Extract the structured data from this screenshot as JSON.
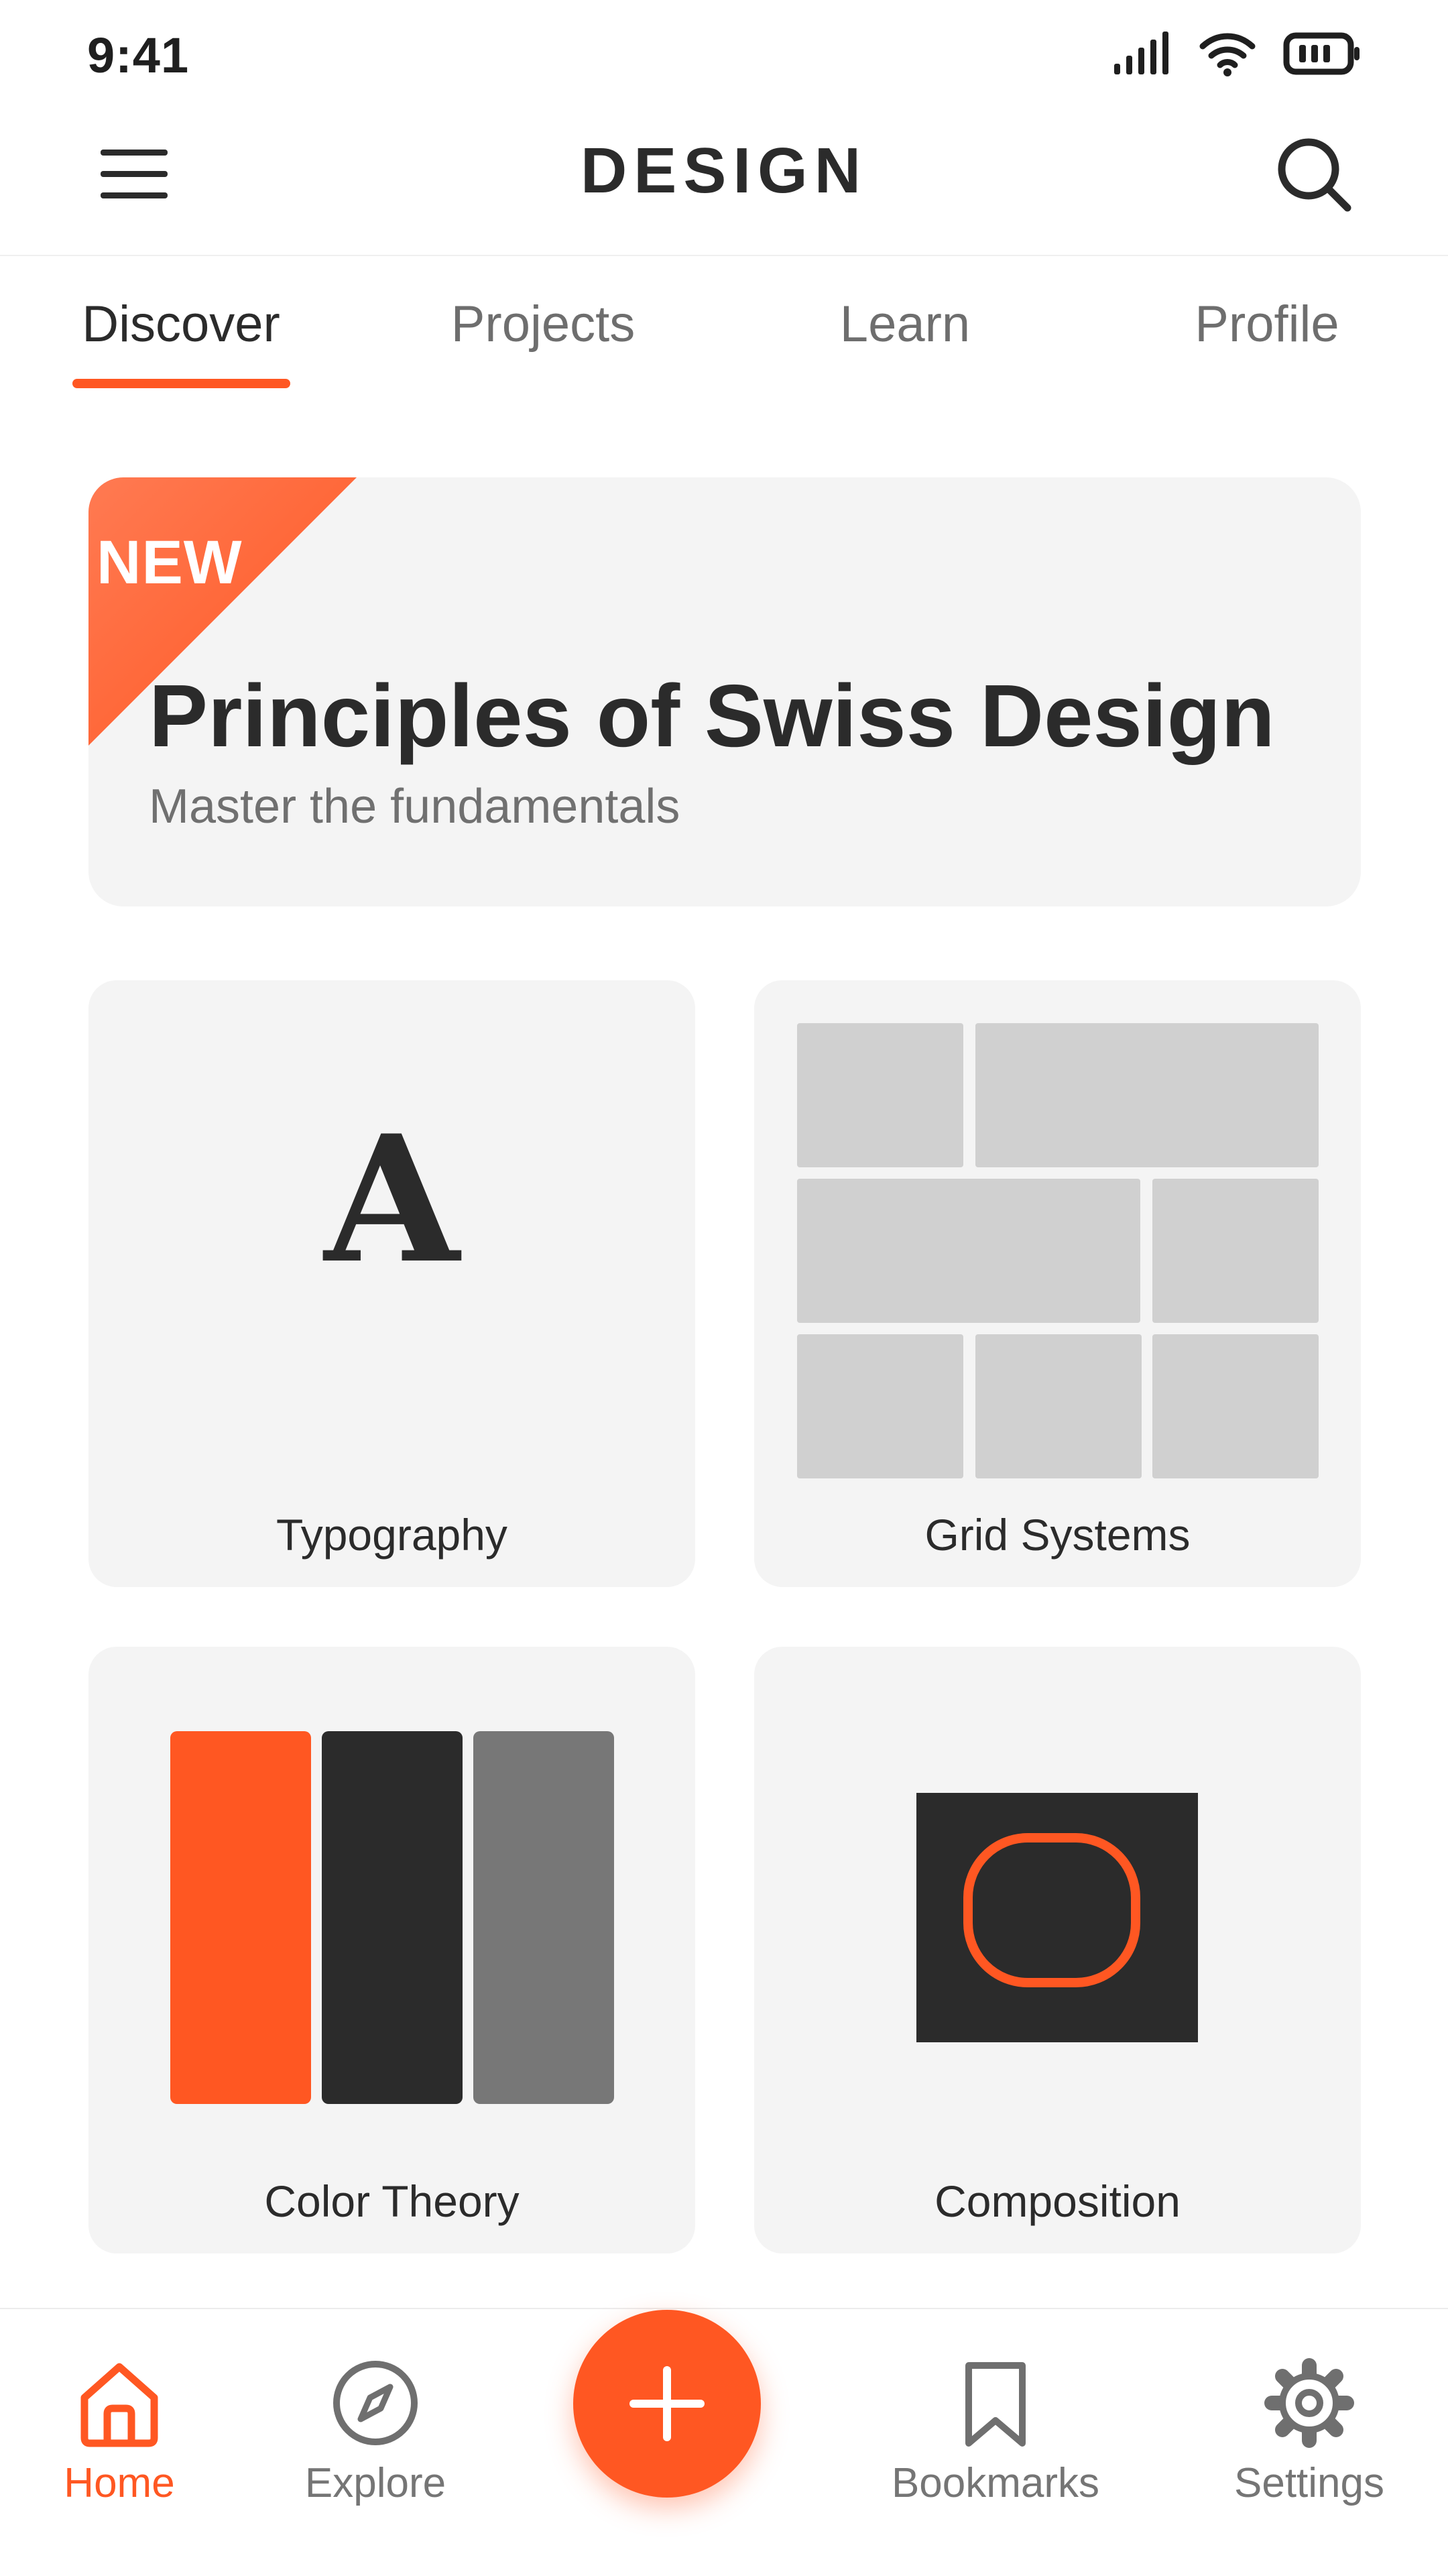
{
  "status_bar": {
    "time": "9:41",
    "icons": [
      "signal-icon",
      "wifi-icon",
      "battery-icon"
    ]
  },
  "header": {
    "title": "DESIGN",
    "menu_icon": "menu-icon",
    "search_icon": "search-icon"
  },
  "tabs": [
    {
      "label": "Discover",
      "active": true
    },
    {
      "label": "Projects",
      "active": false
    },
    {
      "label": "Learn",
      "active": false
    },
    {
      "label": "Profile",
      "active": false
    }
  ],
  "hero": {
    "badge": "NEW",
    "title": "Principles of Swiss Design",
    "subtitle": "Master the fundamentals"
  },
  "tiles": [
    {
      "label": "Typography",
      "glyph": "A"
    },
    {
      "label": "Grid Systems"
    },
    {
      "label": "Color Theory",
      "swatches": [
        "#ff5722",
        "#2b2b2b",
        "#777777"
      ]
    },
    {
      "label": "Composition"
    }
  ],
  "bottom_nav": {
    "items": [
      {
        "label": "Home",
        "icon": "home-icon",
        "active": true
      },
      {
        "label": "Explore",
        "icon": "compass-icon",
        "active": false
      },
      {
        "label": "Bookmarks",
        "icon": "bookmark-icon",
        "active": false
      },
      {
        "label": "Settings",
        "icon": "gear-icon",
        "active": false
      }
    ],
    "fab_icon": "plus-icon"
  },
  "colors": {
    "accent": "#ff5722",
    "text": "#2b2b2b",
    "muted": "#707070",
    "card": "#f4f4f4"
  }
}
